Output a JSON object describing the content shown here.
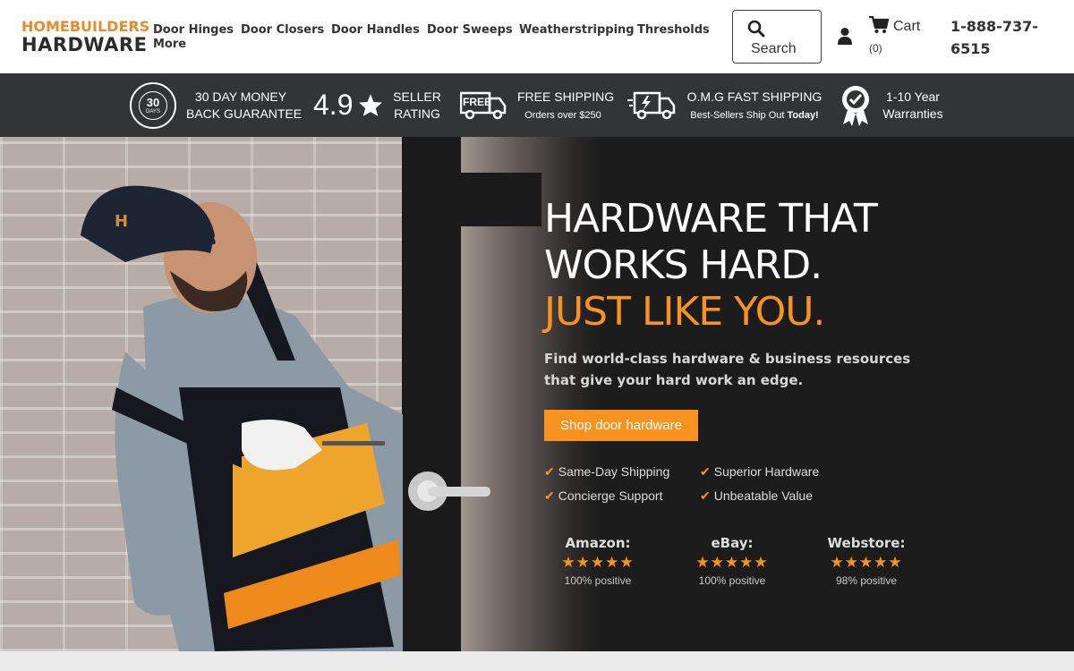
{
  "header": {
    "logo_line1": "HOMEBUILDERS",
    "logo_line2": "HARDWARE",
    "nav": [
      "Door Hinges",
      "Door Closers",
      "Door Handles",
      "Door Sweeps",
      "Weatherstripping",
      "Thresholds",
      "More"
    ],
    "search_label": "Search",
    "cart_label": "Cart",
    "cart_count": "(0)",
    "phone_line1": "1-888-737-",
    "phone_line2": "6515"
  },
  "trust_bar": {
    "money_back_badge_number": "30",
    "money_back_badge_text": "DAYS",
    "money_back_line1": "30 DAY MONEY",
    "money_back_line2": "BACK GUARANTEE",
    "rating_value": "4.9",
    "rating_line1": "SELLER",
    "rating_line2": "RATING",
    "free_badge": "FREE",
    "shipping_line1": "FREE SHIPPING",
    "shipping_line2": "Orders over $250",
    "fast_line1": "O.M.G FAST SHIPPING",
    "fast_line2_prefix": "Best-Sellers Ship Out ",
    "fast_line2_bold": "Today!",
    "warranty_line1": "1-10 Year",
    "warranty_line2": "Warranties"
  },
  "hero": {
    "title_line1": "HARDWARE THAT",
    "title_line2": "WORKS HARD.",
    "title_line3": "JUST LIKE YOU.",
    "subtitle": "Find world-class hardware & business resources that give your hard work an edge.",
    "cta_label": "Shop door hardware",
    "features": [
      "Same-Day Shipping",
      "Superior Hardware",
      "Concierge Support",
      "Unbeatable Value"
    ],
    "reviews": [
      {
        "name": "Amazon:",
        "stars": "★★★★★",
        "percent": "100% positive"
      },
      {
        "name": "eBay:",
        "stars": "★★★★★",
        "percent": "100% positive"
      },
      {
        "name": "Webstore:",
        "stars": "★★★★★",
        "percent": "98% positive"
      }
    ]
  },
  "colors": {
    "accent": "#f7931e",
    "dark": "#333435"
  }
}
